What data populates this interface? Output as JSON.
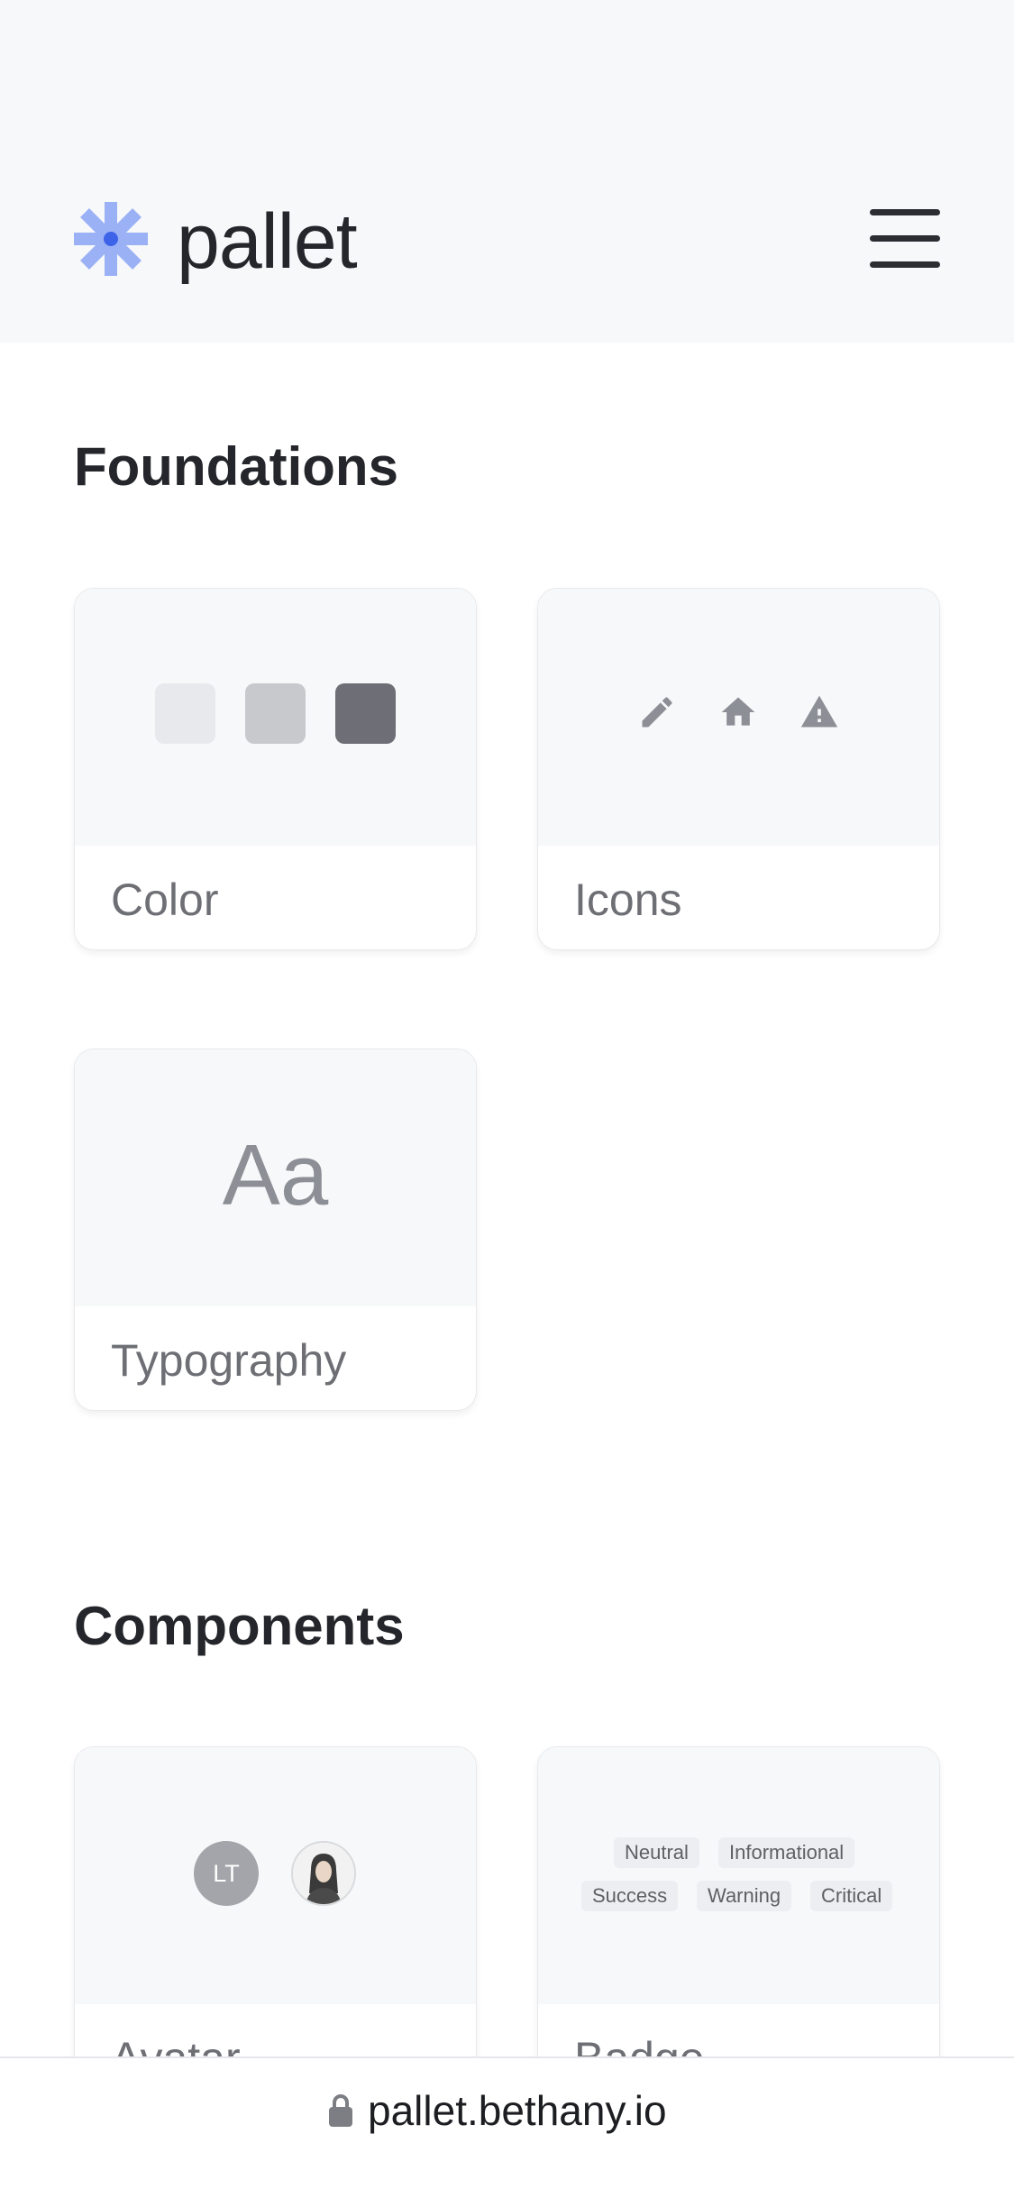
{
  "app": {
    "brand": "pallet"
  },
  "header": {
    "menu_icon": "hamburger-menu-icon",
    "logo_icon": "asterisk-logo-icon"
  },
  "foundations": {
    "title": "Foundations",
    "cards": [
      {
        "label": "Color",
        "swatches": [
          "#e8e9ec",
          "#c8c9cc",
          "#6d6e76"
        ]
      },
      {
        "label": "Icons",
        "icons": [
          "pencil-icon",
          "home-icon",
          "warning-icon"
        ]
      },
      {
        "label": "Typography",
        "sample": "Aa"
      }
    ]
  },
  "components": {
    "title": "Components",
    "cards": [
      {
        "label": "Avatar",
        "initials": "LT"
      },
      {
        "label": "Badge",
        "badges": [
          "Neutral",
          "Informational",
          "Success",
          "Warning",
          "Critical"
        ]
      }
    ]
  },
  "browser": {
    "url": "pallet.bethany.io",
    "lock_icon": "lock-icon"
  },
  "colors": {
    "brand_accent": "#5b7ff2",
    "text_primary": "#25262b",
    "text_secondary": "#6e6f75"
  }
}
